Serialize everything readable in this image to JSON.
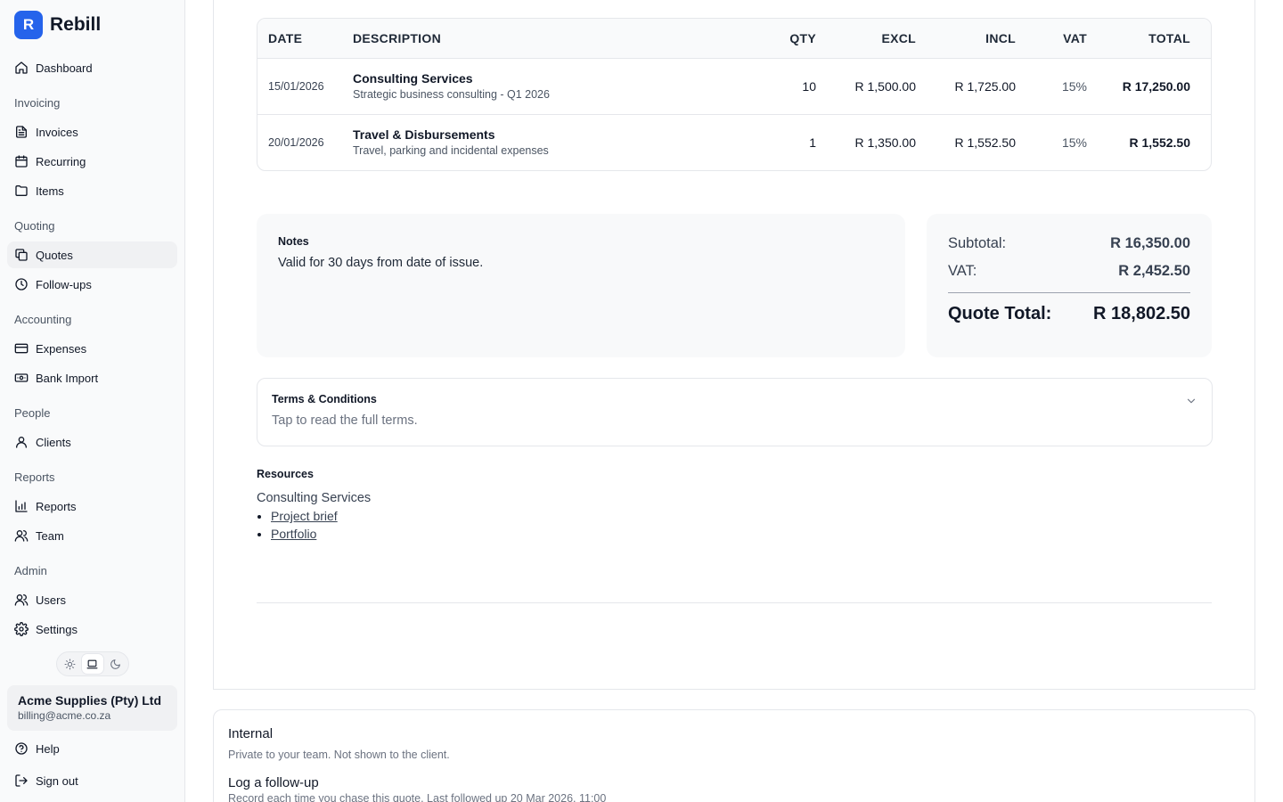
{
  "brand": {
    "logo_letter": "R",
    "name": "Rebill",
    "accent": "#2563eb"
  },
  "sidebar": {
    "dashboard": "Dashboard",
    "sections": {
      "invoicing": "Invoicing",
      "quoting": "Quoting",
      "accounting": "Accounting",
      "people": "People",
      "reports": "Reports",
      "admin": "Admin"
    },
    "items": {
      "invoices": "Invoices",
      "recurring": "Recurring",
      "items": "Items",
      "quotes": "Quotes",
      "followups": "Follow-ups",
      "expenses": "Expenses",
      "bank_import": "Bank Import",
      "clients": "Clients",
      "reports": "Reports",
      "team": "Team",
      "users": "Users",
      "settings": "Settings"
    },
    "active_item": "Quotes",
    "theme_selected": "system",
    "account": {
      "name": "Acme Supplies (Pty) Ltd",
      "email": "billing@acme.co.za"
    },
    "help": "Help",
    "sign_out": "Sign out"
  },
  "table": {
    "headers": {
      "date": "DATE",
      "description": "DESCRIPTION",
      "qty": "QTY",
      "excl": "EXCL",
      "incl": "INCL",
      "vat": "VAT",
      "total": "TOTAL"
    },
    "rows": [
      {
        "date": "15/01/2026",
        "name": "Consulting Services",
        "detail": "Strategic business consulting - Q1 2026",
        "qty": "10",
        "excl": "R 1,500.00",
        "incl": "R 1,725.00",
        "vat": "15%",
        "total": "R 17,250.00"
      },
      {
        "date": "20/01/2026",
        "name": "Travel & Disbursements",
        "detail": "Travel, parking and incidental expenses",
        "qty": "1",
        "excl": "R 1,350.00",
        "incl": "R 1,552.50",
        "vat": "15%",
        "total": "R 1,552.50"
      }
    ]
  },
  "notes": {
    "title": "Notes",
    "text": "Valid for 30 days from date of issue."
  },
  "totals": {
    "subtotal_label": "Subtotal:",
    "subtotal": "R 16,350.00",
    "vat_label": "VAT:",
    "vat": "R 2,452.50",
    "total_label": "Quote Total:",
    "total": "R 18,802.50"
  },
  "terms": {
    "title": "Terms & Conditions",
    "subtitle": "Tap to read the full terms."
  },
  "resources": {
    "title": "Resources",
    "group": "Consulting Services",
    "links": [
      "Project brief",
      "Portfolio"
    ]
  },
  "internal": {
    "title": "Internal",
    "subtitle": "Private to your team. Not shown to the client.",
    "followup_title": "Log a follow-up",
    "followup_sub": "Record each time you chase this quote. Last followed up 20 Mar 2026, 11:00"
  }
}
